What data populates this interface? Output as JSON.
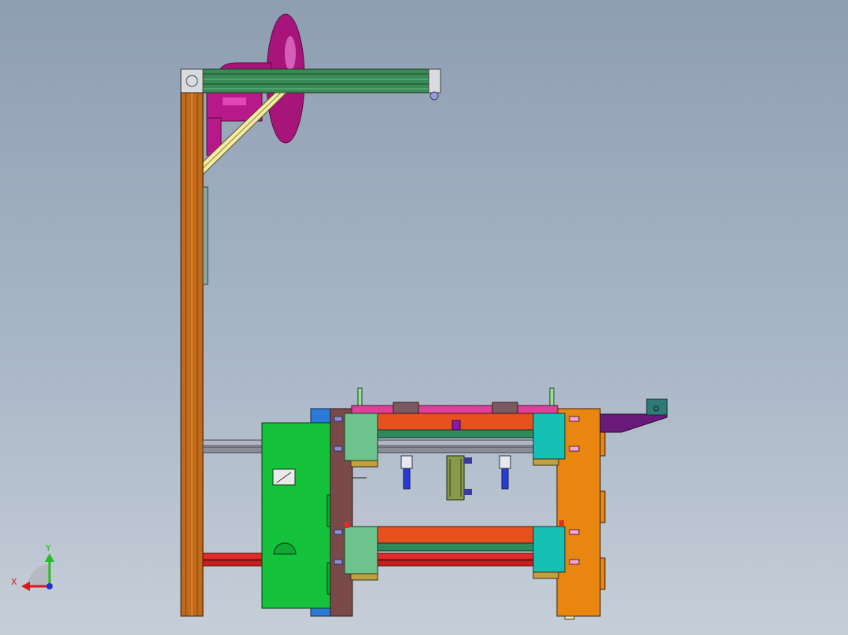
{
  "triad": {
    "x_label": "X",
    "y_label": "Y"
  },
  "colors": {
    "background_top": "#8e9eb2",
    "background_bottom": "#c6ced8",
    "frame_column": "#c06a1a",
    "top_beam": "#3f8a58",
    "pipe_magenta": "#b0187e",
    "brace_yellow": "#f3eca0",
    "green_housing": "#14c23c",
    "orange_plate": "#e8860f",
    "brown_plate": "#7a4a4a",
    "orange_block": "#e8501e",
    "teal_block": "#16c0b4",
    "light_green_block": "#6cc38c",
    "red_rail": "#e22a2a",
    "gray_rail": "#9a9aa6",
    "blue_base": "#2c7ad8",
    "pink_strip": "#e0409c",
    "purple_bracket": "#6a1a7a",
    "axis_x": "#e01818",
    "axis_y": "#1ec01e",
    "axis_z": "#1c30d8"
  }
}
